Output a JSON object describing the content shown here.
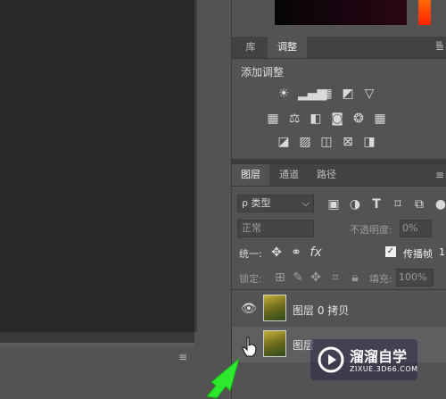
{
  "tabs_top": {
    "library": "库",
    "adjustments": "调整"
  },
  "adjustments": {
    "title": "添加调整",
    "icons": [
      "brightness-contrast-icon",
      "levels-icon",
      "curves-icon",
      "exposure-icon",
      "vibrance-icon",
      "hue-saturation-icon",
      "color-balance-icon",
      "black-white-icon",
      "photo-filter-icon",
      "channel-mixer-icon",
      "color-lookup-icon",
      "invert-icon",
      "posterize-icon",
      "threshold-icon",
      "gradient-map-icon",
      "selective-color-icon"
    ]
  },
  "layers_tabs": {
    "layers": "图层",
    "channels": "通道",
    "paths": "路径"
  },
  "filter": {
    "kind_label": "类型",
    "search_glyph": "ρ"
  },
  "blend": {
    "mode": "正常",
    "opacity_label": "不透明度:",
    "opacity_value": "0%"
  },
  "unify": {
    "label": "统一:",
    "propagate_label": "传播帧",
    "propagate_value": "1"
  },
  "lock": {
    "label": "锁定:",
    "fill_label": "填充:",
    "fill_value": "100%"
  },
  "layers": [
    {
      "name": "图层 0 拷贝",
      "visible": true
    },
    {
      "name": "图层",
      "visible": false
    }
  ],
  "watermark": {
    "brand": "溜溜自学",
    "url": "ZIXUE.3D66.COM"
  },
  "colors": {
    "panel_bg": "#535353",
    "canvas_bg": "#282828",
    "arrow": "#2ee82e"
  }
}
